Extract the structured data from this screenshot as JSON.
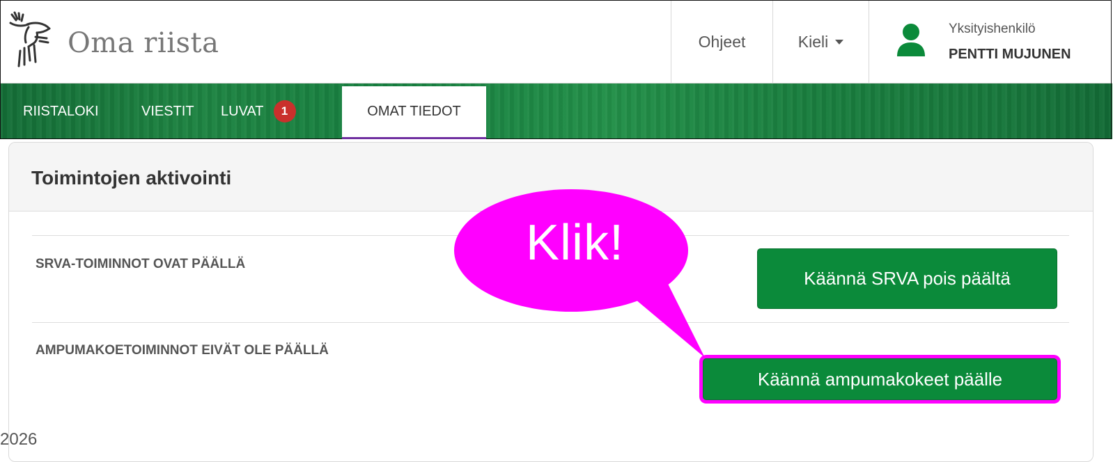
{
  "header": {
    "brand": "Oma riista",
    "help_label": "Ohjeet",
    "language_label": "Kieli",
    "user": {
      "role": "Yksityishenkilö",
      "name": "PENTTI MUJUNEN"
    }
  },
  "nav": {
    "items": [
      {
        "label": "RIISTALOKI"
      },
      {
        "label": "VIESTIT"
      },
      {
        "label": "LUVAT",
        "badge": "1"
      },
      {
        "label": "OMAT TIEDOT",
        "active": true
      }
    ]
  },
  "panel": {
    "title": "Toimintojen aktivointi",
    "rows": [
      {
        "label": "SRVA-TOIMINNOT OVAT PÄÄLLÄ",
        "button": "Käännä SRVA pois päältä"
      },
      {
        "label": "AMPUMAKOETOIMINNOT EIVÄT OLE PÄÄLLÄ",
        "button": "Käännä ampumakokeet päälle"
      }
    ]
  },
  "callout": {
    "text": "Klik!"
  },
  "footer": {
    "year": "2026"
  },
  "colors": {
    "brand_green": "#1e8442",
    "button_green": "#0b8a3a",
    "badge_red": "#c9302c",
    "callout_magenta": "#ff00ff",
    "active_underline": "#7030a0"
  },
  "icons": {
    "logo": "moose-head-icon",
    "user": "user-icon",
    "dropdown": "caret-down-icon"
  }
}
